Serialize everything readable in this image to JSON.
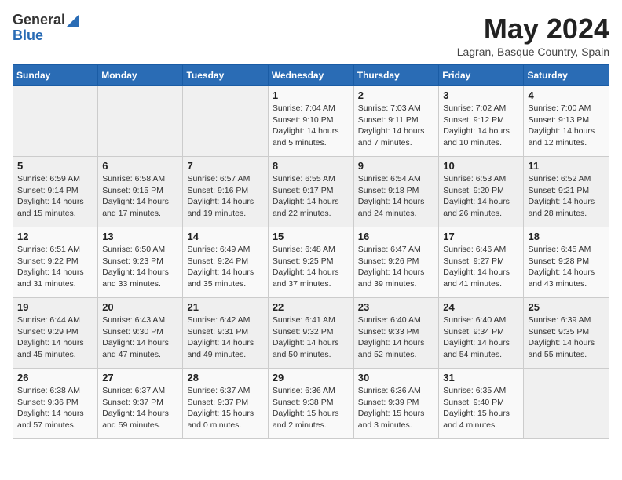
{
  "header": {
    "logo_general": "General",
    "logo_blue": "Blue",
    "title": "May 2024",
    "location": "Lagran, Basque Country, Spain"
  },
  "weekdays": [
    "Sunday",
    "Monday",
    "Tuesday",
    "Wednesday",
    "Thursday",
    "Friday",
    "Saturday"
  ],
  "weeks": [
    [
      {
        "day": "",
        "info": ""
      },
      {
        "day": "",
        "info": ""
      },
      {
        "day": "",
        "info": ""
      },
      {
        "day": "1",
        "info": "Sunrise: 7:04 AM\nSunset: 9:10 PM\nDaylight: 14 hours\nand 5 minutes."
      },
      {
        "day": "2",
        "info": "Sunrise: 7:03 AM\nSunset: 9:11 PM\nDaylight: 14 hours\nand 7 minutes."
      },
      {
        "day": "3",
        "info": "Sunrise: 7:02 AM\nSunset: 9:12 PM\nDaylight: 14 hours\nand 10 minutes."
      },
      {
        "day": "4",
        "info": "Sunrise: 7:00 AM\nSunset: 9:13 PM\nDaylight: 14 hours\nand 12 minutes."
      }
    ],
    [
      {
        "day": "5",
        "info": "Sunrise: 6:59 AM\nSunset: 9:14 PM\nDaylight: 14 hours\nand 15 minutes."
      },
      {
        "day": "6",
        "info": "Sunrise: 6:58 AM\nSunset: 9:15 PM\nDaylight: 14 hours\nand 17 minutes."
      },
      {
        "day": "7",
        "info": "Sunrise: 6:57 AM\nSunset: 9:16 PM\nDaylight: 14 hours\nand 19 minutes."
      },
      {
        "day": "8",
        "info": "Sunrise: 6:55 AM\nSunset: 9:17 PM\nDaylight: 14 hours\nand 22 minutes."
      },
      {
        "day": "9",
        "info": "Sunrise: 6:54 AM\nSunset: 9:18 PM\nDaylight: 14 hours\nand 24 minutes."
      },
      {
        "day": "10",
        "info": "Sunrise: 6:53 AM\nSunset: 9:20 PM\nDaylight: 14 hours\nand 26 minutes."
      },
      {
        "day": "11",
        "info": "Sunrise: 6:52 AM\nSunset: 9:21 PM\nDaylight: 14 hours\nand 28 minutes."
      }
    ],
    [
      {
        "day": "12",
        "info": "Sunrise: 6:51 AM\nSunset: 9:22 PM\nDaylight: 14 hours\nand 31 minutes."
      },
      {
        "day": "13",
        "info": "Sunrise: 6:50 AM\nSunset: 9:23 PM\nDaylight: 14 hours\nand 33 minutes."
      },
      {
        "day": "14",
        "info": "Sunrise: 6:49 AM\nSunset: 9:24 PM\nDaylight: 14 hours\nand 35 minutes."
      },
      {
        "day": "15",
        "info": "Sunrise: 6:48 AM\nSunset: 9:25 PM\nDaylight: 14 hours\nand 37 minutes."
      },
      {
        "day": "16",
        "info": "Sunrise: 6:47 AM\nSunset: 9:26 PM\nDaylight: 14 hours\nand 39 minutes."
      },
      {
        "day": "17",
        "info": "Sunrise: 6:46 AM\nSunset: 9:27 PM\nDaylight: 14 hours\nand 41 minutes."
      },
      {
        "day": "18",
        "info": "Sunrise: 6:45 AM\nSunset: 9:28 PM\nDaylight: 14 hours\nand 43 minutes."
      }
    ],
    [
      {
        "day": "19",
        "info": "Sunrise: 6:44 AM\nSunset: 9:29 PM\nDaylight: 14 hours\nand 45 minutes."
      },
      {
        "day": "20",
        "info": "Sunrise: 6:43 AM\nSunset: 9:30 PM\nDaylight: 14 hours\nand 47 minutes."
      },
      {
        "day": "21",
        "info": "Sunrise: 6:42 AM\nSunset: 9:31 PM\nDaylight: 14 hours\nand 49 minutes."
      },
      {
        "day": "22",
        "info": "Sunrise: 6:41 AM\nSunset: 9:32 PM\nDaylight: 14 hours\nand 50 minutes."
      },
      {
        "day": "23",
        "info": "Sunrise: 6:40 AM\nSunset: 9:33 PM\nDaylight: 14 hours\nand 52 minutes."
      },
      {
        "day": "24",
        "info": "Sunrise: 6:40 AM\nSunset: 9:34 PM\nDaylight: 14 hours\nand 54 minutes."
      },
      {
        "day": "25",
        "info": "Sunrise: 6:39 AM\nSunset: 9:35 PM\nDaylight: 14 hours\nand 55 minutes."
      }
    ],
    [
      {
        "day": "26",
        "info": "Sunrise: 6:38 AM\nSunset: 9:36 PM\nDaylight: 14 hours\nand 57 minutes."
      },
      {
        "day": "27",
        "info": "Sunrise: 6:37 AM\nSunset: 9:37 PM\nDaylight: 14 hours\nand 59 minutes."
      },
      {
        "day": "28",
        "info": "Sunrise: 6:37 AM\nSunset: 9:37 PM\nDaylight: 15 hours\nand 0 minutes."
      },
      {
        "day": "29",
        "info": "Sunrise: 6:36 AM\nSunset: 9:38 PM\nDaylight: 15 hours\nand 2 minutes."
      },
      {
        "day": "30",
        "info": "Sunrise: 6:36 AM\nSunset: 9:39 PM\nDaylight: 15 hours\nand 3 minutes."
      },
      {
        "day": "31",
        "info": "Sunrise: 6:35 AM\nSunset: 9:40 PM\nDaylight: 15 hours\nand 4 minutes."
      },
      {
        "day": "",
        "info": ""
      }
    ]
  ]
}
